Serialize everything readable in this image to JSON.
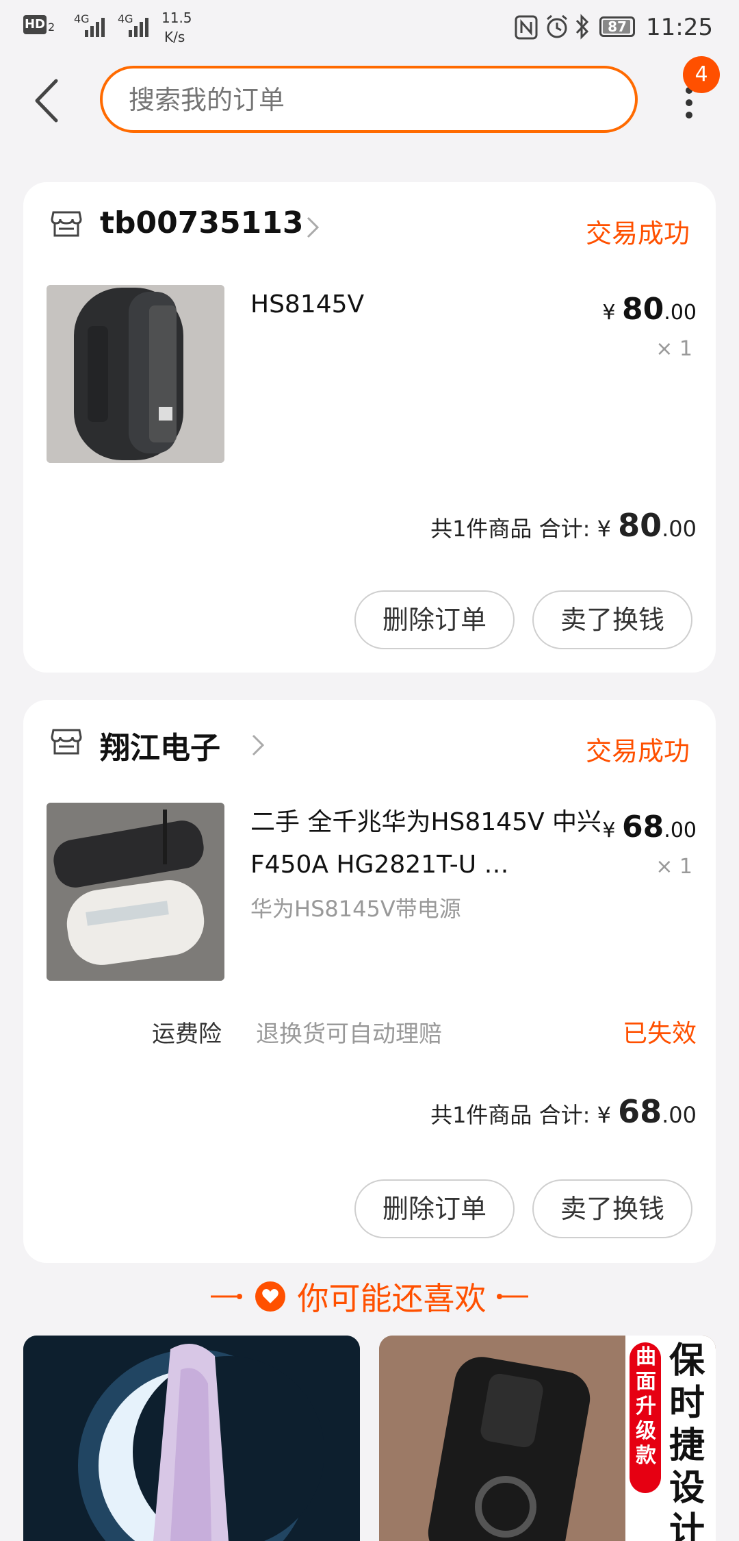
{
  "status_bar": {
    "net_label": "HD",
    "net_sub": "2",
    "signal1": "4G",
    "signal2": "4G",
    "speed": "11.5",
    "speed_unit": "K/s",
    "battery": "87",
    "time": "11:25"
  },
  "header": {
    "search_placeholder": "搜索我的订单",
    "badge_count": "4"
  },
  "orders": [
    {
      "shop": "tb00735113",
      "status": "交易成功",
      "title": "HS8145V",
      "subtitle": "",
      "price_symbol": "¥",
      "price_int": "80",
      "price_dec": ".00",
      "qty": "× 1",
      "summary_label": "共1件商品 合计:",
      "total_int": "80",
      "total_dec": ".00",
      "btn_delete": "删除订单",
      "btn_sell": "卖了换钱"
    },
    {
      "shop": "翔江电子",
      "status": "交易成功",
      "title": "二手 全千兆华为HS8145V 中兴F450A HG2821T-U …",
      "subtitle": "华为HS8145V带电源",
      "price_symbol": "¥",
      "price_int": "68",
      "price_dec": ".00",
      "qty": "× 1",
      "insurance_label": "运费险",
      "insurance_desc": "退换货可自动理赔",
      "insurance_status": "已失效",
      "summary_label": "共1件商品 合计:",
      "total_int": "68",
      "total_dec": ".00",
      "btn_delete": "删除订单",
      "btn_sell": "卖了换钱"
    }
  ],
  "recommend": {
    "title": "你可能还喜欢",
    "item2_tag": "曲面升级款",
    "item2_slogan": "保时捷设计"
  },
  "colors": {
    "accent": "#ff5000",
    "search_border": "#ff6a00",
    "background": "#f4f3f5"
  }
}
